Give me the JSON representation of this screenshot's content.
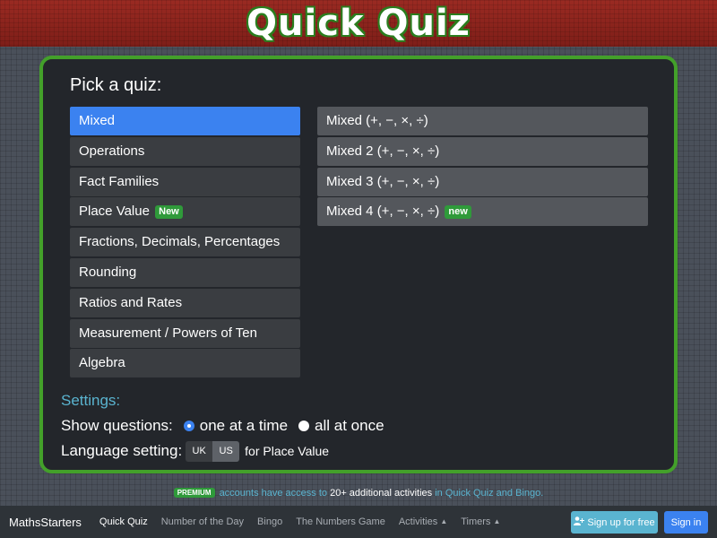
{
  "header": {
    "title": "Quick Quiz"
  },
  "panel": {
    "pick_title": "Pick a quiz:",
    "categories": [
      {
        "label": "Mixed",
        "active": true,
        "badge": ""
      },
      {
        "label": "Operations",
        "badge": ""
      },
      {
        "label": "Fact Families",
        "badge": ""
      },
      {
        "label": "Place Value",
        "badge": "New"
      },
      {
        "label": "Fractions, Decimals, Percentages",
        "badge": ""
      },
      {
        "label": "Rounding",
        "badge": ""
      },
      {
        "label": "Ratios and Rates",
        "badge": ""
      },
      {
        "label": "Measurement / Powers of Ten",
        "badge": ""
      },
      {
        "label": "Algebra",
        "badge": ""
      }
    ],
    "quizzes": [
      {
        "label": "Mixed (+, −, ×, ÷)",
        "badge": ""
      },
      {
        "label": "Mixed 2 (+, −, ×, ÷)",
        "badge": ""
      },
      {
        "label": "Mixed 3 (+, −, ×, ÷)",
        "badge": ""
      },
      {
        "label": "Mixed 4 (+, −, ×, ÷)",
        "badge": "new"
      }
    ]
  },
  "settings": {
    "title": "Settings:",
    "show_questions_label": "Show questions:",
    "option_one": "one at a time",
    "option_all": "all at once",
    "selected": "one at a time",
    "language_label": "Language setting:",
    "lang_uk": "UK",
    "lang_us": "US",
    "selected_language": "US",
    "language_note": "for Place Value"
  },
  "premium": {
    "badge": "PREMIUM",
    "text_1": "accounts have access to",
    "strong": "20+ additional activities",
    "text_2": "in Quick Quiz and Bingo."
  },
  "navbar": {
    "brand": "MathsStarters",
    "links": [
      "Quick Quiz",
      "Number of the Day",
      "Bingo",
      "The Numbers Game",
      "Activities",
      "Timers"
    ],
    "signup": "Sign up for free",
    "signin": "Sign in"
  },
  "colors": {
    "accent_blue": "#3b82f0",
    "panel_border_green": "#43a02a",
    "header_red": "#8c241d",
    "settings_teal": "#5ab4d0",
    "badge_green": "#2f9a3a"
  },
  "icons": {
    "user_plus": "user-plus-icon",
    "caret": "caret-up-icon",
    "radio": "radio-icon"
  }
}
